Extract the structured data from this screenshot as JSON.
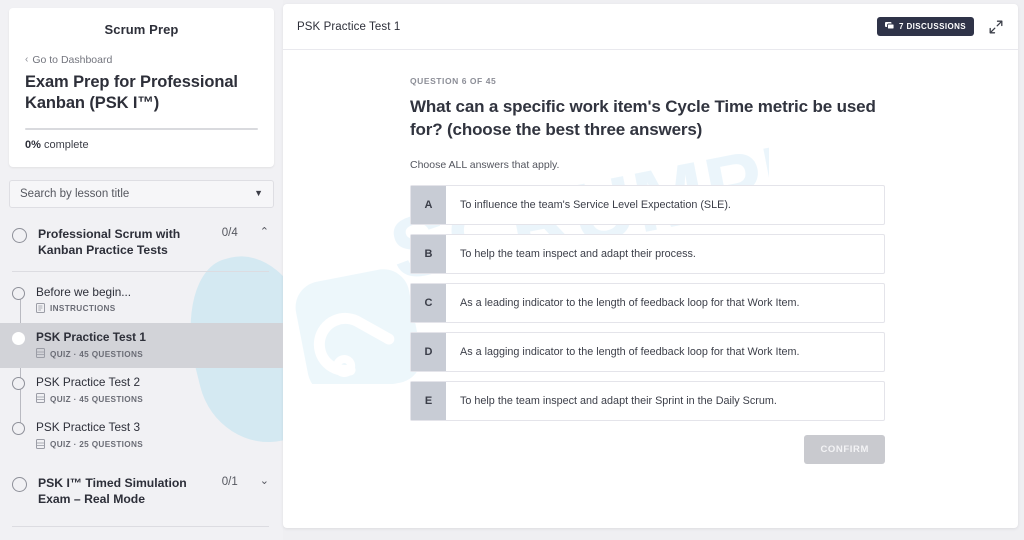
{
  "sidebar": {
    "brand": "Scrum Prep",
    "dashboard_link": "Go to Dashboard",
    "back_chevron": "‹",
    "course_title": "Exam Prep for Professional Kanban (PSK I™)",
    "progress_percent": "0%",
    "progress_label_suffix": " complete",
    "progress_value": 0,
    "search_placeholder": "Search by lesson title",
    "search_value": "",
    "sections": [
      {
        "title": "Professional Scrum with Kanban Practice Tests",
        "count": "0/4",
        "chevron": "⌃",
        "expanded": true,
        "lessons": [
          {
            "title": "Before we begin...",
            "meta": "INSTRUCTIONS",
            "icon": "document-icon",
            "active": false
          },
          {
            "title": "PSK Practice Test 1",
            "meta": "QUIZ · 45 QUESTIONS",
            "icon": "quiz-icon",
            "active": true
          },
          {
            "title": "PSK Practice Test 2",
            "meta": "QUIZ · 45 QUESTIONS",
            "icon": "quiz-icon",
            "active": false
          },
          {
            "title": "PSK Practice Test 3",
            "meta": "QUIZ · 25 QUESTIONS",
            "icon": "quiz-icon",
            "active": false
          }
        ]
      },
      {
        "title": "PSK I™ Timed Simulation Exam – Real Mode",
        "count": "0/1",
        "chevron": "⌄",
        "expanded": false,
        "lessons": []
      }
    ]
  },
  "header": {
    "title": "PSK Practice Test 1",
    "discussions_label": "7 DISCUSSIONS",
    "discussions_icon": "comments-icon",
    "expand_icon": "expand-icon",
    "badge_color": "#2f3348"
  },
  "quiz": {
    "counter": "QUESTION 6 OF 45",
    "question": "What can a specific work item's Cycle Time metric be used for? (choose the best three answers)",
    "hint": "Choose ALL answers that apply.",
    "options": [
      {
        "letter": "A",
        "text": "To influence the team's Service Level Expectation (SLE)."
      },
      {
        "letter": "B",
        "text": "To help the team inspect and adapt their process."
      },
      {
        "letter": "C",
        "text": "As a leading indicator to the length of feedback loop for that Work Item."
      },
      {
        "letter": "D",
        "text": "As a lagging indicator to the length of feedback loop for that Work Item."
      },
      {
        "letter": "E",
        "text": "To help the team inspect and adapt their Sprint in the Daily Scrum."
      }
    ],
    "confirm_label": "CONFIRM"
  },
  "watermark": {
    "text": "SCRUMPREP",
    "color": "#d6ecf7"
  }
}
